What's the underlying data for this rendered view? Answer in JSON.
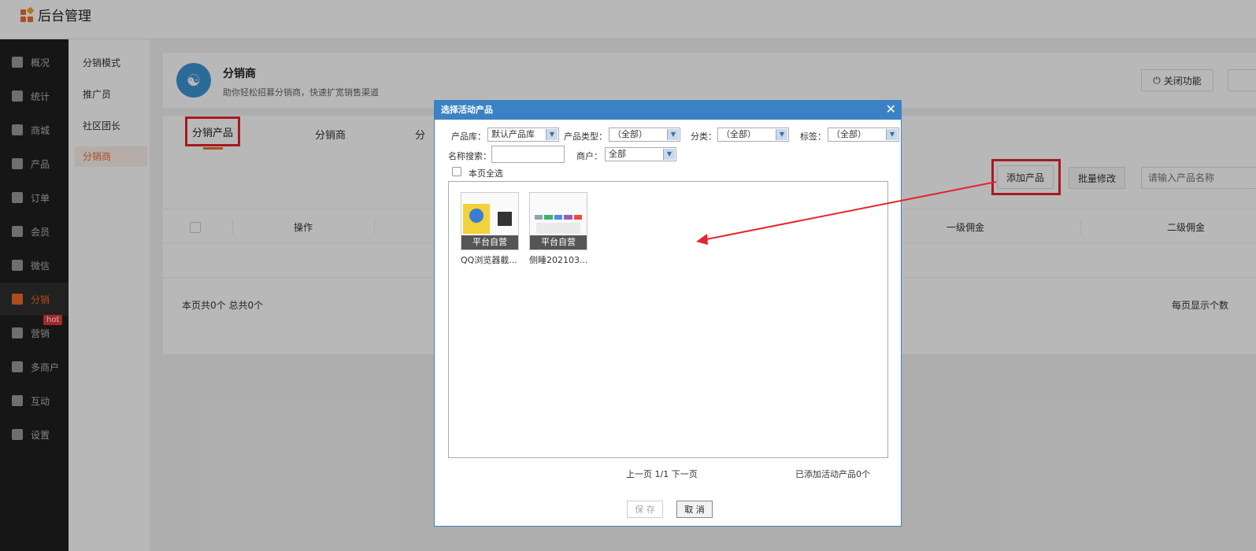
{
  "app": {
    "title": "后台管理"
  },
  "sidebar": {
    "items": [
      {
        "label": "概况",
        "icon": "layers-icon"
      },
      {
        "label": "统计",
        "icon": "chart-icon"
      },
      {
        "label": "商城",
        "icon": "shop-icon"
      },
      {
        "label": "产品",
        "icon": "grid-icon"
      },
      {
        "label": "订单",
        "icon": "clipboard-icon"
      },
      {
        "label": "会员",
        "icon": "crown-icon"
      },
      {
        "label": "微信",
        "icon": "wechat-icon"
      },
      {
        "label": "分销",
        "icon": "users-icon",
        "active": true
      },
      {
        "label": "营销",
        "icon": "flag-icon",
        "badge": "hot"
      },
      {
        "label": "多商户",
        "icon": "store-icon"
      },
      {
        "label": "互动",
        "icon": "apps-icon"
      },
      {
        "label": "设置",
        "icon": "gear-icon"
      }
    ]
  },
  "subnav": {
    "items": [
      {
        "label": "分销模式"
      },
      {
        "label": "推广员"
      },
      {
        "label": "社区团长"
      },
      {
        "label": "分销商",
        "active": true
      }
    ]
  },
  "header": {
    "title": "分销商",
    "subtitle": "助你轻松招募分销商，快速扩宽销售渠道",
    "close_button": "关闭功能"
  },
  "tabs": [
    "分销产品",
    "分销商",
    "分"
  ],
  "toolbar": {
    "add_product": "添加产品",
    "batch_edit": "批量修改",
    "search_placeholder": "请输入产品名称"
  },
  "table": {
    "columns": [
      "操作",
      "一级佣金",
      "二级佣金"
    ],
    "summary": "本页共0个  总共0个",
    "per_page_label": "每页显示个数"
  },
  "modal": {
    "title": "选择活动产品",
    "filters": {
      "library_label": "产品库：",
      "library_value": "默认产品库",
      "type_label": "产品类型：",
      "type_value": "（全部）",
      "category_label": "分类：",
      "category_value": "（全部）",
      "tag_label": "标签：",
      "tag_value": "（全部）",
      "name_search_label": "名称搜索：",
      "name_search_value": "",
      "merchant_label": "商户：",
      "merchant_value": "全部"
    },
    "select_all_label": "本页全选",
    "products": [
      {
        "name": "QQ浏览器截...",
        "tag": "平台自营"
      },
      {
        "name": "侧睡202103...",
        "tag": "平台自营"
      }
    ],
    "pager": "上一页 1/1 下一页",
    "added_count": "已添加活动产品0个",
    "save_label": "保 存",
    "cancel_label": "取 消"
  },
  "colors": {
    "accent": "#f06b2f",
    "modal_header": "#3b82c4",
    "highlight_red": "#e3262f",
    "sidebar_bg": "#1f1f1f"
  }
}
